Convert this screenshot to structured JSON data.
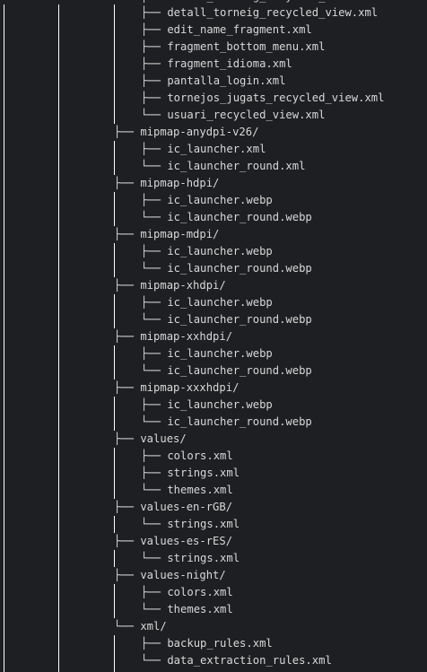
{
  "top_partial": "├── detail_torneig_recycled_view.xml",
  "rows": [
    {
      "depth": 3,
      "text": "├── detall_torneig_recycled_view.xml"
    },
    {
      "depth": 3,
      "text": "├── edit_name_fragment.xml"
    },
    {
      "depth": 3,
      "text": "├── fragment_bottom_menu.xml"
    },
    {
      "depth": 3,
      "text": "├── fragment_idioma.xml"
    },
    {
      "depth": 3,
      "text": "├── pantalla_login.xml"
    },
    {
      "depth": 3,
      "text": "├── tornejos_jugats_recycled_view.xml"
    },
    {
      "depth": 3,
      "text": "└── usuari_recycled_view.xml"
    },
    {
      "depth": 2,
      "text": "├── mipmap-anydpi-v26/"
    },
    {
      "depth": 3,
      "text": "├── ic_launcher.xml"
    },
    {
      "depth": 3,
      "text": "└── ic_launcher_round.xml"
    },
    {
      "depth": 2,
      "text": "├── mipmap-hdpi/"
    },
    {
      "depth": 3,
      "text": "├── ic_launcher.webp"
    },
    {
      "depth": 3,
      "text": "└── ic_launcher_round.webp"
    },
    {
      "depth": 2,
      "text": "├── mipmap-mdpi/"
    },
    {
      "depth": 3,
      "text": "├── ic_launcher.webp"
    },
    {
      "depth": 3,
      "text": "└── ic_launcher_round.webp"
    },
    {
      "depth": 2,
      "text": "├── mipmap-xhdpi/"
    },
    {
      "depth": 3,
      "text": "├── ic_launcher.webp"
    },
    {
      "depth": 3,
      "text": "└── ic_launcher_round.webp"
    },
    {
      "depth": 2,
      "text": "├── mipmap-xxhdpi/"
    },
    {
      "depth": 3,
      "text": "├── ic_launcher.webp"
    },
    {
      "depth": 3,
      "text": "└── ic_launcher_round.webp"
    },
    {
      "depth": 2,
      "text": "├── mipmap-xxxhdpi/"
    },
    {
      "depth": 3,
      "text": "├── ic_launcher.webp"
    },
    {
      "depth": 3,
      "text": "└── ic_launcher_round.webp"
    },
    {
      "depth": 2,
      "text": "├── values/"
    },
    {
      "depth": 3,
      "text": "├── colors.xml"
    },
    {
      "depth": 3,
      "text": "├── strings.xml"
    },
    {
      "depth": 3,
      "text": "└── themes.xml"
    },
    {
      "depth": 2,
      "text": "├── values-en-rGB/"
    },
    {
      "depth": 3,
      "text": "└── strings.xml"
    },
    {
      "depth": 2,
      "text": "├── values-es-rES/"
    },
    {
      "depth": 3,
      "text": "└── strings.xml"
    },
    {
      "depth": 2,
      "text": "├── values-night/"
    },
    {
      "depth": 3,
      "text": "├── colors.xml"
    },
    {
      "depth": 3,
      "text": "└── themes.xml"
    },
    {
      "depth": 2,
      "text": "└── xml/"
    },
    {
      "depth": 3,
      "text": "├── backup_rules.xml"
    },
    {
      "depth": 3,
      "text": "└── data_extraction_rules.xml"
    }
  ]
}
